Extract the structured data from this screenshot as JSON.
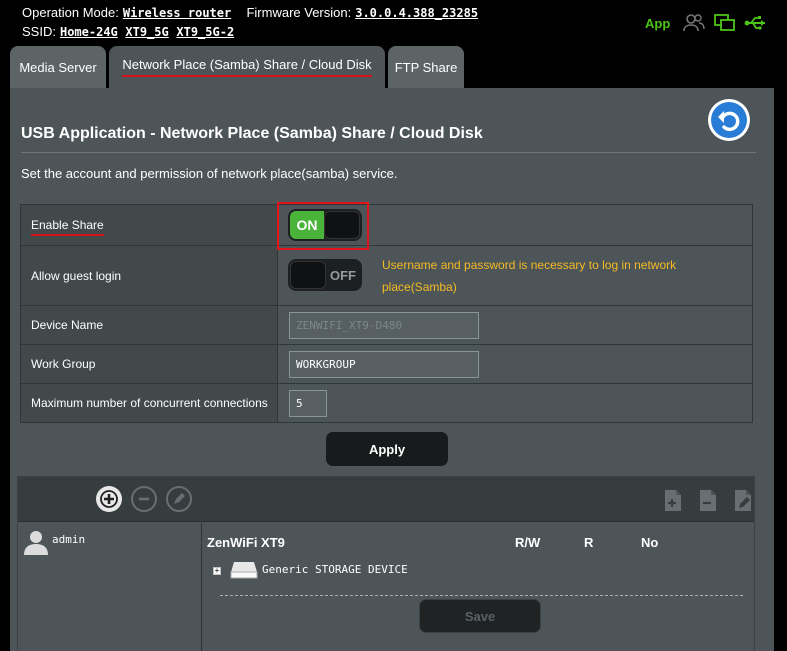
{
  "status": {
    "mode_label": "Operation Mode:",
    "mode_value": "Wireless router",
    "fw_label": "Firmware Version:",
    "fw_value": "3.0.0.4.388_23285",
    "ssid_label": "SSID:",
    "ssids": [
      "Home-24G",
      "XT9_5G",
      "XT9_5G-2"
    ],
    "app_label": "App",
    "icons": [
      "users-icon",
      "network-monitor-icon",
      "usb-icon"
    ],
    "accent_color": "#4cc417"
  },
  "tabs": [
    {
      "label": "Media Server",
      "active": false
    },
    {
      "label": "Network Place (Samba) Share / Cloud Disk",
      "active": true
    },
    {
      "label": "FTP Share",
      "active": false
    }
  ],
  "page": {
    "title": "USB Application - Network Place (Samba) Share / Cloud Disk",
    "description": "Set the account and permission of network place(samba) service.",
    "back_icon": "back-arrow-icon"
  },
  "settings": {
    "enable_share": {
      "label": "Enable Share",
      "value": "ON"
    },
    "guest_login": {
      "label": "Allow guest login",
      "value": "OFF",
      "hint": "Username and password is necessary to log in network place(Samba)"
    },
    "device_name": {
      "label": "Device Name",
      "value": "ZENWIFI_XT9-D480"
    },
    "work_group": {
      "label": "Work Group",
      "value": "WORKGROUP"
    },
    "max_conn": {
      "label": "Maximum number of concurrent connections",
      "value": "5"
    },
    "highlight_color": "#e0141b"
  },
  "apply_label": "Apply",
  "accounts": {
    "toolbar_icons": [
      "add-account-icon",
      "remove-account-icon",
      "edit-account-icon"
    ],
    "folder_icons": [
      "add-folder-icon",
      "delete-folder-icon",
      "edit-folder-icon"
    ],
    "users": [
      {
        "name": "admin"
      }
    ],
    "tree_title": "ZenWiFi XT9",
    "columns": [
      "R/W",
      "R",
      "No"
    ],
    "device": "Generic STORAGE DEVICE",
    "save_label": "Save"
  }
}
